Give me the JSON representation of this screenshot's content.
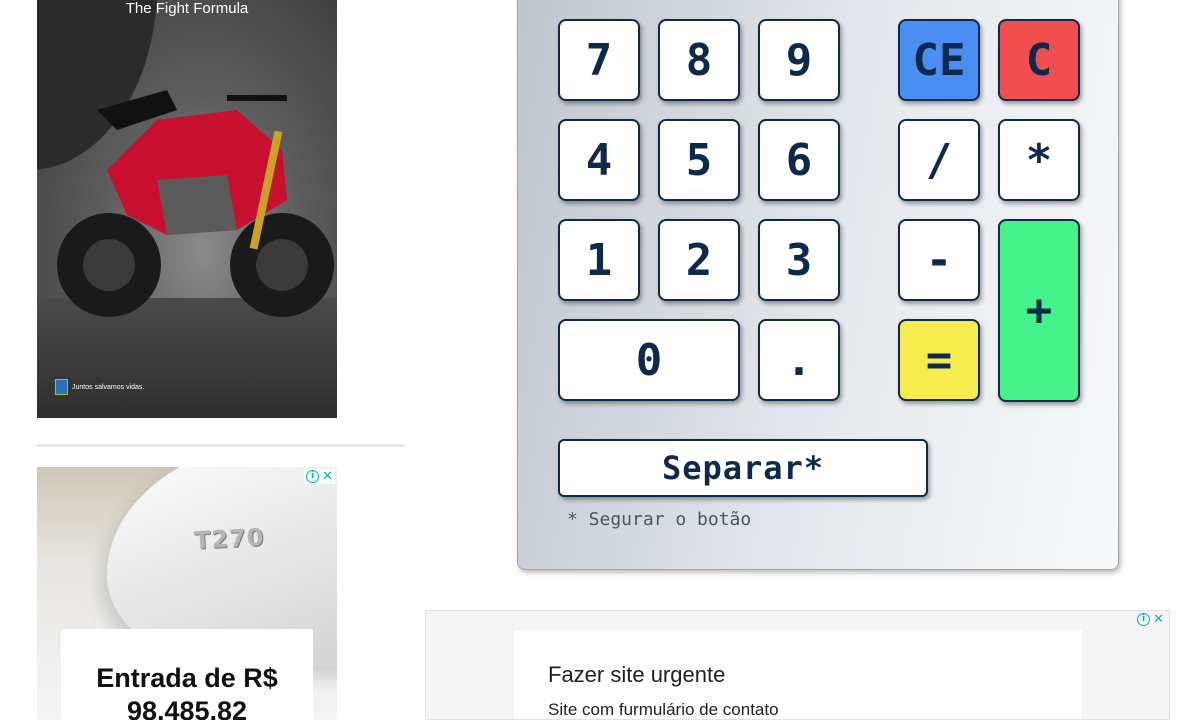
{
  "ads": {
    "left_top": {
      "headline": "The Fight Formula",
      "footer": "Juntos salvamos vidas."
    },
    "left_bottom": {
      "badge": "T270",
      "line1": "Entrada de R$",
      "line2": "98.485,82"
    },
    "bottom": {
      "title": "Fazer site urgente",
      "subtitle": "Site com furmulário de contato"
    },
    "ad_choices": {
      "info_glyph": "i",
      "close_glyph": "✕"
    }
  },
  "calculator": {
    "keys": {
      "seven": "7",
      "eight": "8",
      "nine": "9",
      "four": "4",
      "five": "5",
      "six": "6",
      "one": "1",
      "two": "2",
      "three": "3",
      "zero": "0",
      "dot": ".",
      "clear_entry": "CE",
      "clear": "C",
      "divide": "/",
      "multiply": "*",
      "minus": "-",
      "plus": "+",
      "equals": "="
    },
    "separate_label": "Separar*",
    "hint": "* Segurar o botão"
  },
  "colors": {
    "key_border": "#0d2a4d",
    "ce": "#4b8df0",
    "c": "#f14f4f",
    "equals": "#f7ec4d",
    "plus": "#45f28a"
  }
}
